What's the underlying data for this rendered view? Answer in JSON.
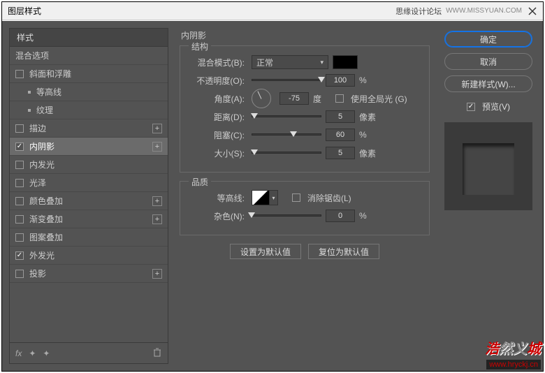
{
  "window": {
    "title": "图层样式",
    "forum": "思缘设计论坛",
    "url": "WWW.MISSYUAN.COM"
  },
  "left": {
    "header": "样式",
    "items": [
      {
        "label": "混合选项",
        "type": "plain"
      },
      {
        "label": "斜面和浮雕",
        "type": "check",
        "checked": false
      },
      {
        "label": "等高线",
        "type": "sub"
      },
      {
        "label": "纹理",
        "type": "sub"
      },
      {
        "label": "描边",
        "type": "check",
        "checked": false,
        "plus": true
      },
      {
        "label": "内阴影",
        "type": "check",
        "checked": true,
        "plus": true,
        "selected": true
      },
      {
        "label": "内发光",
        "type": "check",
        "checked": false
      },
      {
        "label": "光泽",
        "type": "check",
        "checked": false
      },
      {
        "label": "颜色叠加",
        "type": "check",
        "checked": false,
        "plus": true
      },
      {
        "label": "渐变叠加",
        "type": "check",
        "checked": false,
        "plus": true
      },
      {
        "label": "图案叠加",
        "type": "check",
        "checked": false
      },
      {
        "label": "外发光",
        "type": "check",
        "checked": true
      },
      {
        "label": "投影",
        "type": "check",
        "checked": false,
        "plus": true
      }
    ],
    "footer_fx": "fx"
  },
  "center": {
    "title": "内阴影",
    "structure": {
      "legend": "结构",
      "blend_label": "混合模式(B):",
      "blend_value": "正常",
      "opacity_label": "不透明度(O):",
      "opacity_value": "100",
      "opacity_unit": "%",
      "angle_label": "角度(A):",
      "angle_value": "-75",
      "angle_unit": "度",
      "global_light_label": "使用全局光 (G)",
      "distance_label": "距离(D):",
      "distance_value": "5",
      "distance_unit": "像素",
      "choke_label": "阻塞(C):",
      "choke_value": "60",
      "choke_unit": "%",
      "size_label": "大小(S):",
      "size_value": "5",
      "size_unit": "像素"
    },
    "quality": {
      "legend": "品质",
      "contour_label": "等高线:",
      "antialias_label": "消除锯齿(L)",
      "noise_label": "杂色(N):",
      "noise_value": "0",
      "noise_unit": "%"
    },
    "set_default": "设置为默认值",
    "reset_default": "复位为默认值"
  },
  "right": {
    "ok": "确定",
    "cancel": "取消",
    "new_style": "新建样式(W)...",
    "preview": "预览(V)"
  },
  "watermark": {
    "line1a": "浩",
    "line1b": "然义",
    "line1c": "城",
    "line2": "www.hryckj.cn"
  }
}
